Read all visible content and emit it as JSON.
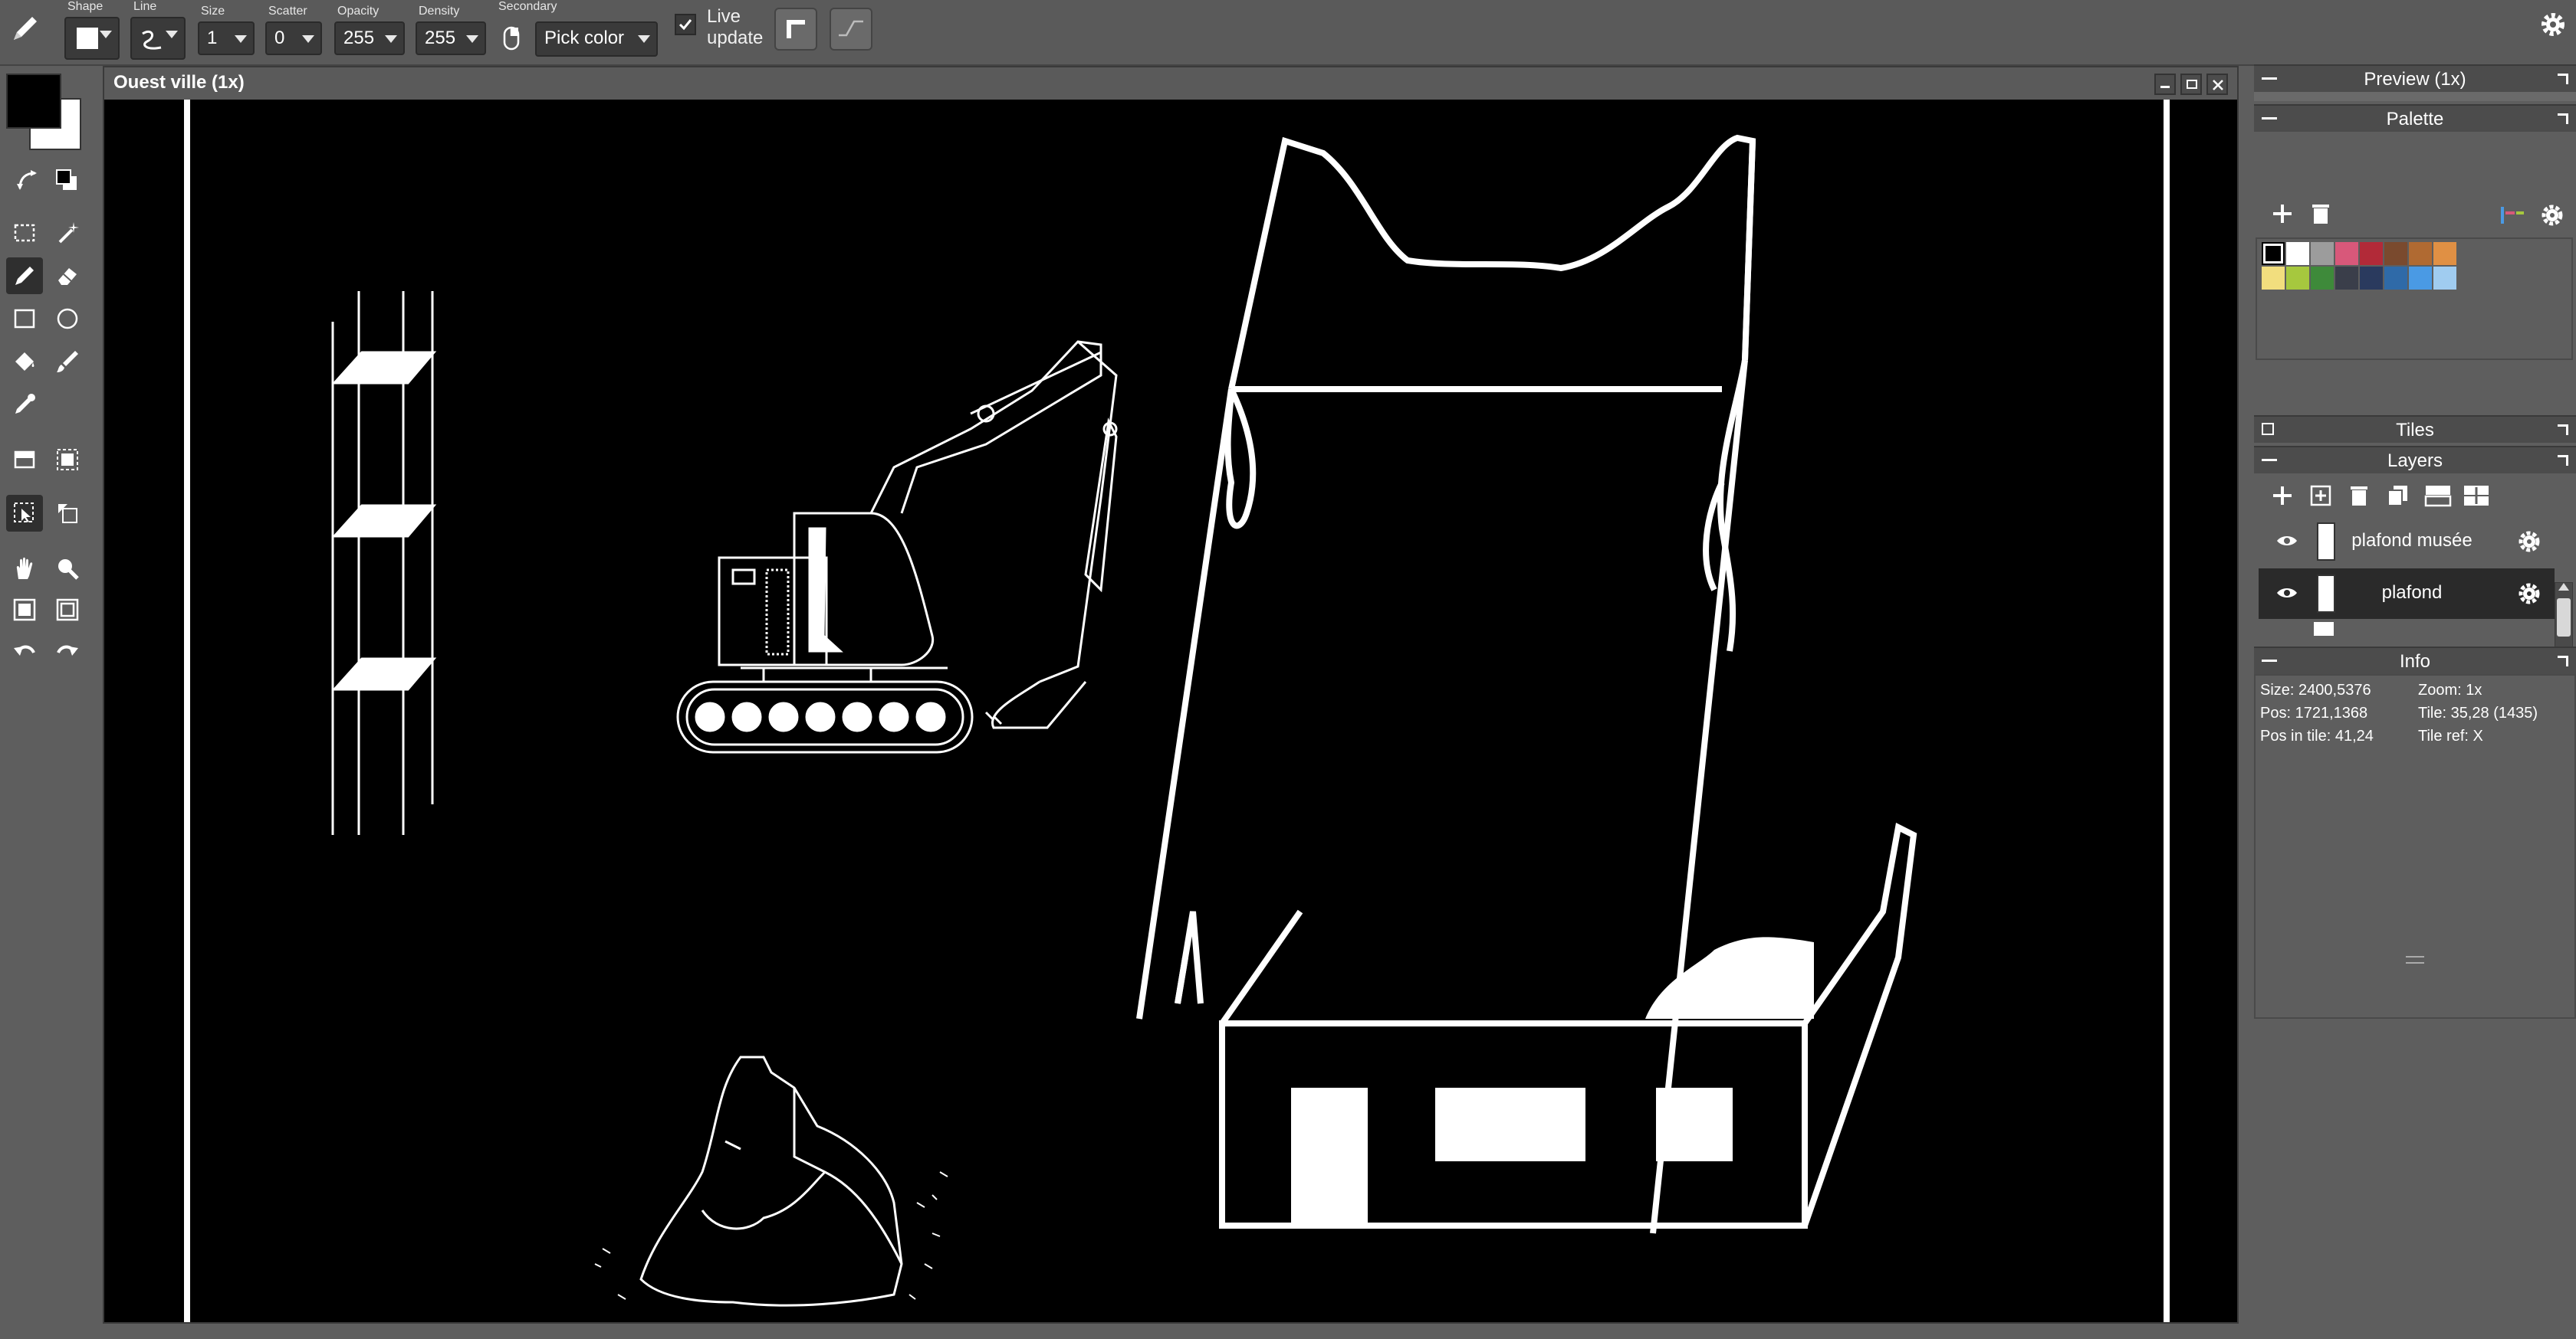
{
  "toolbar": {
    "labels": {
      "shape": "Shape",
      "line": "Line",
      "size": "Size",
      "scatter": "Scatter",
      "opacity": "Opacity",
      "density": "Density",
      "secondary": "Secondary"
    },
    "size_value": "1",
    "scatter_value": "0",
    "opacity_value": "255",
    "density_value": "255",
    "secondary_value": "Pick color",
    "live_update_line1": "Live",
    "live_update_line2": "update",
    "live_update_checked": true
  },
  "document": {
    "title": "Ouest ville   (1x)"
  },
  "panels": {
    "preview_title": "Preview (1x)",
    "palette_title": "Palette",
    "tiles_title": "Tiles",
    "layers_title": "Layers",
    "info_title": "Info"
  },
  "palette": {
    "row1": [
      "#000000",
      "#ffffff",
      "#9c9c9c",
      "#d8587a",
      "#b22a38",
      "#7a4a2e",
      "#b06a32",
      "#e09044"
    ],
    "row2": [
      "#f2de7e",
      "#a6c83e",
      "#3e8a3a",
      "#3a3e4a",
      "#2a3a5e",
      "#2f6aa8",
      "#4a9ae4",
      "#a0ccf0"
    ]
  },
  "layers": [
    {
      "name": "plafond musée",
      "visible": true
    },
    {
      "name": "plafond",
      "visible": true
    }
  ],
  "info": {
    "size": "Size: 2400,5376",
    "zoom": "Zoom: 1x",
    "pos": "Pos: 1721,1368",
    "tile": "Tile: 35,28 (1435)",
    "pos_in_tile": "Pos in tile: 41,24",
    "tile_ref": "Tile ref: X"
  },
  "colors": {
    "foreground": "#000000",
    "background": "#ffffff",
    "canvas": "#000000",
    "ui_bg": "#5e5e5e"
  }
}
